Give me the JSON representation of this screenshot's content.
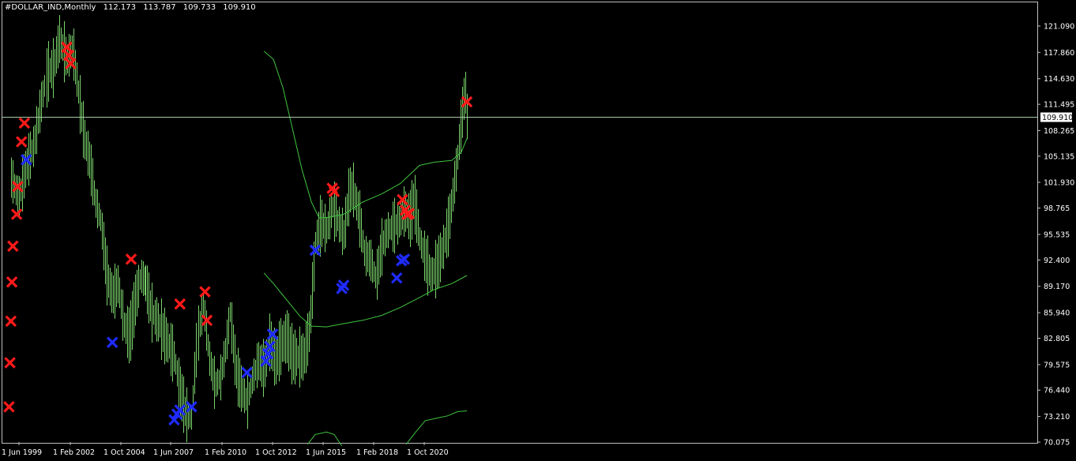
{
  "header": {
    "symbol": "#DOLLAR_IND,Monthly",
    "open": "112.173",
    "high": "113.787",
    "low": "109.733",
    "close": "109.910"
  },
  "price_label": "109.910",
  "colors": {
    "background": "#000000",
    "bars": "#7bd46b",
    "bands": "#3fc43f",
    "sell_marker": "#ff1a1a",
    "buy_marker": "#1f2bff",
    "axis_text": "#ffffff"
  },
  "chart_data": {
    "type": "line",
    "title": "#DOLLAR_IND,Monthly",
    "yticks": [
      "121.090",
      "117.860",
      "114.630",
      "111.495",
      "108.265",
      "105.135",
      "101.930",
      "98.765",
      "95.535",
      "92.400",
      "89.170",
      "85.940",
      "82.805",
      "79.575",
      "76.440",
      "73.210",
      "70.075"
    ],
    "ylim": [
      70.075,
      121.09
    ],
    "xticks": [
      "1 Jun 1999",
      "1 Feb 2002",
      "1 Oct 2004",
      "1 Jun 2007",
      "1 Feb 2010",
      "1 Oct 2012",
      "1 Jun 2015",
      "1 Feb 2018",
      "1 Oct 2020"
    ],
    "current_price": 109.91,
    "price_series": [
      {
        "t": 1999.0,
        "v": 102.5
      },
      {
        "t": 1999.4,
        "v": 100.0
      },
      {
        "t": 1999.8,
        "v": 104.0
      },
      {
        "t": 2000.2,
        "v": 106.5
      },
      {
        "t": 2000.6,
        "v": 112.0
      },
      {
        "t": 2000.9,
        "v": 115.5
      },
      {
        "t": 2001.2,
        "v": 116.0
      },
      {
        "t": 2001.5,
        "v": 119.5
      },
      {
        "t": 2001.9,
        "v": 117.0
      },
      {
        "t": 2002.2,
        "v": 118.5
      },
      {
        "t": 2002.5,
        "v": 113.0
      },
      {
        "t": 2002.8,
        "v": 107.5
      },
      {
        "t": 2003.1,
        "v": 104.5
      },
      {
        "t": 2003.4,
        "v": 99.5
      },
      {
        "t": 2003.7,
        "v": 97.0
      },
      {
        "t": 2004.0,
        "v": 90.5
      },
      {
        "t": 2004.3,
        "v": 88.0
      },
      {
        "t": 2004.6,
        "v": 89.5
      },
      {
        "t": 2004.9,
        "v": 84.5
      },
      {
        "t": 2005.2,
        "v": 83.0
      },
      {
        "t": 2005.5,
        "v": 87.5
      },
      {
        "t": 2005.8,
        "v": 90.5
      },
      {
        "t": 2006.1,
        "v": 89.5
      },
      {
        "t": 2006.4,
        "v": 86.0
      },
      {
        "t": 2006.7,
        "v": 85.0
      },
      {
        "t": 2007.0,
        "v": 83.5
      },
      {
        "t": 2007.3,
        "v": 82.0
      },
      {
        "t": 2007.6,
        "v": 80.5
      },
      {
        "t": 2007.9,
        "v": 76.5
      },
      {
        "t": 2008.2,
        "v": 73.5
      },
      {
        "t": 2008.5,
        "v": 73.0
      },
      {
        "t": 2008.8,
        "v": 83.0
      },
      {
        "t": 2009.1,
        "v": 87.0
      },
      {
        "t": 2009.4,
        "v": 80.5
      },
      {
        "t": 2009.7,
        "v": 77.0
      },
      {
        "t": 2010.0,
        "v": 78.0
      },
      {
        "t": 2010.3,
        "v": 82.0
      },
      {
        "t": 2010.5,
        "v": 86.0
      },
      {
        "t": 2010.8,
        "v": 79.0
      },
      {
        "t": 2011.1,
        "v": 76.5
      },
      {
        "t": 2011.4,
        "v": 75.0
      },
      {
        "t": 2011.7,
        "v": 78.0
      },
      {
        "t": 2012.0,
        "v": 80.0
      },
      {
        "t": 2012.3,
        "v": 79.0
      },
      {
        "t": 2012.6,
        "v": 82.5
      },
      {
        "t": 2012.9,
        "v": 80.0
      },
      {
        "t": 2013.2,
        "v": 82.0
      },
      {
        "t": 2013.5,
        "v": 83.0
      },
      {
        "t": 2013.8,
        "v": 80.5
      },
      {
        "t": 2014.1,
        "v": 80.5
      },
      {
        "t": 2014.4,
        "v": 80.5
      },
      {
        "t": 2014.7,
        "v": 84.0
      },
      {
        "t": 2015.0,
        "v": 94.5
      },
      {
        "t": 2015.3,
        "v": 97.0
      },
      {
        "t": 2015.6,
        "v": 96.0
      },
      {
        "t": 2015.9,
        "v": 99.0
      },
      {
        "t": 2016.2,
        "v": 97.0
      },
      {
        "t": 2016.5,
        "v": 95.5
      },
      {
        "t": 2016.8,
        "v": 101.0
      },
      {
        "t": 2017.0,
        "v": 101.0
      },
      {
        "t": 2017.3,
        "v": 98.0
      },
      {
        "t": 2017.6,
        "v": 93.0
      },
      {
        "t": 2017.9,
        "v": 92.5
      },
      {
        "t": 2018.2,
        "v": 90.0
      },
      {
        "t": 2018.5,
        "v": 94.0
      },
      {
        "t": 2018.8,
        "v": 96.0
      },
      {
        "t": 2019.1,
        "v": 96.5
      },
      {
        "t": 2019.4,
        "v": 97.0
      },
      {
        "t": 2019.7,
        "v": 98.5
      },
      {
        "t": 2020.0,
        "v": 97.5
      },
      {
        "t": 2020.2,
        "v": 100.0
      },
      {
        "t": 2020.5,
        "v": 95.0
      },
      {
        "t": 2020.8,
        "v": 92.5
      },
      {
        "t": 2021.1,
        "v": 90.5
      },
      {
        "t": 2021.4,
        "v": 91.5
      },
      {
        "t": 2021.7,
        "v": 93.5
      },
      {
        "t": 2022.0,
        "v": 96.5
      },
      {
        "t": 2022.2,
        "v": 99.5
      },
      {
        "t": 2022.5,
        "v": 105.0
      },
      {
        "t": 2022.7,
        "v": 109.5
      },
      {
        "t": 2022.9,
        "v": 113.5
      },
      {
        "t": 2023.0,
        "v": 110.0
      }
    ],
    "band_upper_right": [
      {
        "t": 2015.6,
        "v": 97.6
      },
      {
        "t": 2016.5,
        "v": 98.0
      },
      {
        "t": 2017.5,
        "v": 99.5
      },
      {
        "t": 2018.5,
        "v": 100.5
      },
      {
        "t": 2019.5,
        "v": 101.8
      },
      {
        "t": 2020.5,
        "v": 104.0
      },
      {
        "t": 2021.3,
        "v": 104.4
      },
      {
        "t": 2022.2,
        "v": 104.6
      },
      {
        "t": 2022.7,
        "v": 105.6
      },
      {
        "t": 2023.0,
        "v": 107.3
      }
    ],
    "band_upper_left": [
      {
        "t": 2012.3,
        "v": 118.0
      },
      {
        "t": 2012.8,
        "v": 117.0
      },
      {
        "t": 2013.3,
        "v": 113.5
      },
      {
        "t": 2013.8,
        "v": 108.5
      },
      {
        "t": 2014.3,
        "v": 103.5
      },
      {
        "t": 2014.8,
        "v": 99.5
      },
      {
        "t": 2015.2,
        "v": 97.6
      },
      {
        "t": 2015.6,
        "v": 97.6
      }
    ],
    "band_lower": [
      {
        "t": 2012.3,
        "v": 90.8
      },
      {
        "t": 2012.8,
        "v": 89.5
      },
      {
        "t": 2013.5,
        "v": 87.5
      },
      {
        "t": 2014.2,
        "v": 85.5
      },
      {
        "t": 2014.8,
        "v": 84.3
      },
      {
        "t": 2015.6,
        "v": 84.2
      },
      {
        "t": 2016.5,
        "v": 84.6
      },
      {
        "t": 2017.5,
        "v": 85.0
      },
      {
        "t": 2018.5,
        "v": 85.6
      },
      {
        "t": 2019.5,
        "v": 86.6
      },
      {
        "t": 2020.5,
        "v": 87.8
      },
      {
        "t": 2021.3,
        "v": 88.8
      },
      {
        "t": 2022.2,
        "v": 89.5
      },
      {
        "t": 2023.0,
        "v": 90.5
      }
    ],
    "band_bottom_arc": [
      {
        "t": 2014.6,
        "v": 69.8
      },
      {
        "t": 2015.0,
        "v": 71.0
      },
      {
        "t": 2015.6,
        "v": 71.3
      },
      {
        "t": 2016.0,
        "v": 71.0
      },
      {
        "t": 2016.4,
        "v": 69.6
      }
    ],
    "band_bottom_right": [
      {
        "t": 2019.8,
        "v": 69.8
      },
      {
        "t": 2020.3,
        "v": 71.3
      },
      {
        "t": 2020.8,
        "v": 72.7
      },
      {
        "t": 2021.4,
        "v": 73.0
      },
      {
        "t": 2022.0,
        "v": 73.3
      },
      {
        "t": 2022.5,
        "v": 73.8
      },
      {
        "t": 2023.0,
        "v": 73.9
      }
    ],
    "sell_markers": [
      {
        "t": 1998.9,
        "v": 74.4
      },
      {
        "t": 1998.95,
        "v": 79.8
      },
      {
        "t": 1999.0,
        "v": 84.9
      },
      {
        "t": 1999.05,
        "v": 89.7
      },
      {
        "t": 1999.1,
        "v": 94.1
      },
      {
        "t": 1999.3,
        "v": 98.0
      },
      {
        "t": 1999.35,
        "v": 101.4
      },
      {
        "t": 1999.55,
        "v": 106.9
      },
      {
        "t": 1999.7,
        "v": 109.2
      },
      {
        "t": 2001.9,
        "v": 118.5
      },
      {
        "t": 2002.0,
        "v": 117.5
      },
      {
        "t": 2002.1,
        "v": 116.5
      },
      {
        "t": 2005.3,
        "v": 92.5
      },
      {
        "t": 2007.9,
        "v": 87.0
      },
      {
        "t": 2009.2,
        "v": 88.5
      },
      {
        "t": 2009.3,
        "v": 85.0
      },
      {
        "t": 2015.9,
        "v": 101.2
      },
      {
        "t": 2016.0,
        "v": 100.8
      },
      {
        "t": 2019.6,
        "v": 99.8
      },
      {
        "t": 2019.75,
        "v": 98.5
      },
      {
        "t": 2019.85,
        "v": 98.0
      },
      {
        "t": 2019.95,
        "v": 98.1
      },
      {
        "t": 2023.0,
        "v": 111.8
      }
    ],
    "buy_markers": [
      {
        "t": 1999.8,
        "v": 104.7
      },
      {
        "t": 2004.3,
        "v": 82.3
      },
      {
        "t": 2007.6,
        "v": 72.8
      },
      {
        "t": 2007.75,
        "v": 73.5
      },
      {
        "t": 2007.9,
        "v": 74.0
      },
      {
        "t": 2008.5,
        "v": 74.4
      },
      {
        "t": 2011.4,
        "v": 78.6
      },
      {
        "t": 2012.4,
        "v": 80.0
      },
      {
        "t": 2012.5,
        "v": 80.9
      },
      {
        "t": 2012.6,
        "v": 81.8
      },
      {
        "t": 2012.75,
        "v": 83.3
      },
      {
        "t": 2015.0,
        "v": 93.6
      },
      {
        "t": 2016.4,
        "v": 88.9
      },
      {
        "t": 2016.5,
        "v": 89.3
      },
      {
        "t": 2019.3,
        "v": 90.2
      },
      {
        "t": 2019.55,
        "v": 92.3
      },
      {
        "t": 2019.7,
        "v": 92.5
      }
    ]
  }
}
